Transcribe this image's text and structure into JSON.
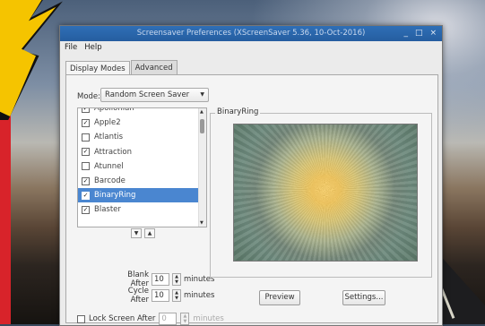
{
  "window": {
    "title": "Screensaver Preferences  (XScreenSaver 5.36, 10-Oct-2016)",
    "controls": [
      "_",
      "□",
      "×"
    ]
  },
  "menu": [
    "File",
    "Help"
  ],
  "tabs": [
    {
      "label": "Display Modes",
      "active": true
    },
    {
      "label": "Advanced",
      "active": false
    }
  ],
  "mode": {
    "label": "Mode:",
    "value": "Random Screen Saver"
  },
  "savers": [
    {
      "name": "Apollonian",
      "checked": true,
      "selected": false
    },
    {
      "name": "Apple2",
      "checked": true,
      "selected": false
    },
    {
      "name": "Atlantis",
      "checked": false,
      "selected": false
    },
    {
      "name": "Attraction",
      "checked": true,
      "selected": false
    },
    {
      "name": "Atunnel",
      "checked": false,
      "selected": false
    },
    {
      "name": "Barcode",
      "checked": true,
      "selected": false
    },
    {
      "name": "BinaryRing",
      "checked": true,
      "selected": true
    },
    {
      "name": "Blaster",
      "checked": true,
      "selected": false
    }
  ],
  "blank_after": {
    "label": "Blank After",
    "value": "10",
    "unit": "minutes"
  },
  "cycle_after": {
    "label": "Cycle After",
    "value": "10",
    "unit": "minutes"
  },
  "lock_screen": {
    "label": "Lock Screen After",
    "value": "0",
    "unit": "minutes",
    "checked": false
  },
  "preview": {
    "title": "BinaryRing",
    "preview_button": "Preview",
    "settings_button": "Settings..."
  }
}
